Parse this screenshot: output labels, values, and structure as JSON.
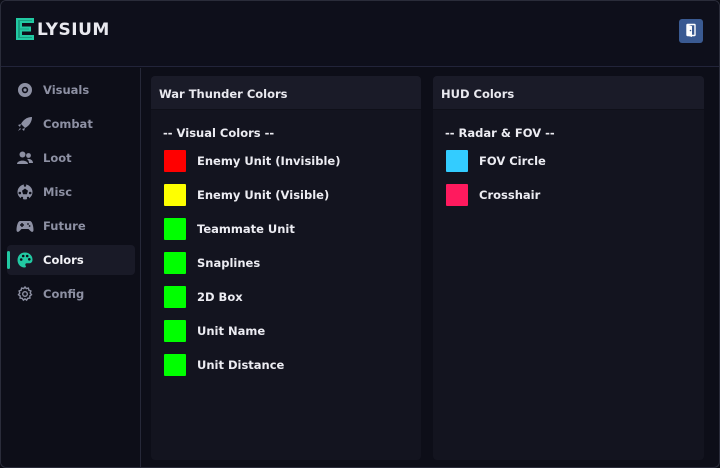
{
  "app": {
    "logo_text": "LYSIUM",
    "logo_letter": "E",
    "accent": "#22c9a3",
    "logout_icon": "door-exit-icon"
  },
  "sidebar": {
    "items": [
      {
        "label": "Visuals",
        "icon": "eye-icon",
        "active": false
      },
      {
        "label": "Combat",
        "icon": "rocket-icon",
        "active": false
      },
      {
        "label": "Loot",
        "icon": "users-icon",
        "active": false
      },
      {
        "label": "Misc",
        "icon": "soccer-ball-icon",
        "active": false
      },
      {
        "label": "Future",
        "icon": "gamepad-icon",
        "active": false
      },
      {
        "label": "Colors",
        "icon": "palette-icon",
        "active": true
      },
      {
        "label": "Config",
        "icon": "gear-icon",
        "active": false
      }
    ]
  },
  "panels": {
    "left": {
      "title": "War Thunder Colors",
      "section": "-- Visual Colors --",
      "colors": [
        {
          "label": "Enemy Unit (Invisible)",
          "color": "#ff0000"
        },
        {
          "label": "Enemy Unit (Visible)",
          "color": "#ffff00"
        },
        {
          "label": "Teammate Unit",
          "color": "#00ff00"
        },
        {
          "label": "Snaplines",
          "color": "#00ff00"
        },
        {
          "label": "2D Box",
          "color": "#00ff00"
        },
        {
          "label": "Unit Name",
          "color": "#00ff00"
        },
        {
          "label": "Unit Distance",
          "color": "#00ff00"
        }
      ]
    },
    "right": {
      "title": "HUD Colors",
      "section": "-- Radar & FOV --",
      "colors": [
        {
          "label": "FOV Circle",
          "color": "#33ccff"
        },
        {
          "label": "Crosshair",
          "color": "#ff1a5e"
        }
      ]
    }
  }
}
